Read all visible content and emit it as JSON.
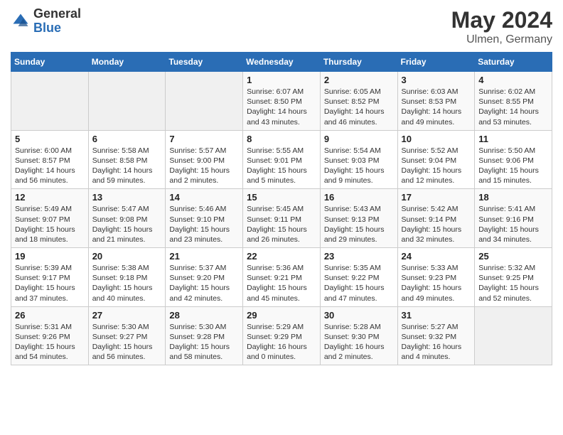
{
  "header": {
    "logo_general": "General",
    "logo_blue": "Blue",
    "month_year": "May 2024",
    "location": "Ulmen, Germany"
  },
  "weekdays": [
    "Sunday",
    "Monday",
    "Tuesday",
    "Wednesday",
    "Thursday",
    "Friday",
    "Saturday"
  ],
  "weeks": [
    [
      {
        "day": "",
        "info": ""
      },
      {
        "day": "",
        "info": ""
      },
      {
        "day": "",
        "info": ""
      },
      {
        "day": "1",
        "info": "Sunrise: 6:07 AM\nSunset: 8:50 PM\nDaylight: 14 hours\nand 43 minutes."
      },
      {
        "day": "2",
        "info": "Sunrise: 6:05 AM\nSunset: 8:52 PM\nDaylight: 14 hours\nand 46 minutes."
      },
      {
        "day": "3",
        "info": "Sunrise: 6:03 AM\nSunset: 8:53 PM\nDaylight: 14 hours\nand 49 minutes."
      },
      {
        "day": "4",
        "info": "Sunrise: 6:02 AM\nSunset: 8:55 PM\nDaylight: 14 hours\nand 53 minutes."
      }
    ],
    [
      {
        "day": "5",
        "info": "Sunrise: 6:00 AM\nSunset: 8:57 PM\nDaylight: 14 hours\nand 56 minutes."
      },
      {
        "day": "6",
        "info": "Sunrise: 5:58 AM\nSunset: 8:58 PM\nDaylight: 14 hours\nand 59 minutes."
      },
      {
        "day": "7",
        "info": "Sunrise: 5:57 AM\nSunset: 9:00 PM\nDaylight: 15 hours\nand 2 minutes."
      },
      {
        "day": "8",
        "info": "Sunrise: 5:55 AM\nSunset: 9:01 PM\nDaylight: 15 hours\nand 5 minutes."
      },
      {
        "day": "9",
        "info": "Sunrise: 5:54 AM\nSunset: 9:03 PM\nDaylight: 15 hours\nand 9 minutes."
      },
      {
        "day": "10",
        "info": "Sunrise: 5:52 AM\nSunset: 9:04 PM\nDaylight: 15 hours\nand 12 minutes."
      },
      {
        "day": "11",
        "info": "Sunrise: 5:50 AM\nSunset: 9:06 PM\nDaylight: 15 hours\nand 15 minutes."
      }
    ],
    [
      {
        "day": "12",
        "info": "Sunrise: 5:49 AM\nSunset: 9:07 PM\nDaylight: 15 hours\nand 18 minutes."
      },
      {
        "day": "13",
        "info": "Sunrise: 5:47 AM\nSunset: 9:08 PM\nDaylight: 15 hours\nand 21 minutes."
      },
      {
        "day": "14",
        "info": "Sunrise: 5:46 AM\nSunset: 9:10 PM\nDaylight: 15 hours\nand 23 minutes."
      },
      {
        "day": "15",
        "info": "Sunrise: 5:45 AM\nSunset: 9:11 PM\nDaylight: 15 hours\nand 26 minutes."
      },
      {
        "day": "16",
        "info": "Sunrise: 5:43 AM\nSunset: 9:13 PM\nDaylight: 15 hours\nand 29 minutes."
      },
      {
        "day": "17",
        "info": "Sunrise: 5:42 AM\nSunset: 9:14 PM\nDaylight: 15 hours\nand 32 minutes."
      },
      {
        "day": "18",
        "info": "Sunrise: 5:41 AM\nSunset: 9:16 PM\nDaylight: 15 hours\nand 34 minutes."
      }
    ],
    [
      {
        "day": "19",
        "info": "Sunrise: 5:39 AM\nSunset: 9:17 PM\nDaylight: 15 hours\nand 37 minutes."
      },
      {
        "day": "20",
        "info": "Sunrise: 5:38 AM\nSunset: 9:18 PM\nDaylight: 15 hours\nand 40 minutes."
      },
      {
        "day": "21",
        "info": "Sunrise: 5:37 AM\nSunset: 9:20 PM\nDaylight: 15 hours\nand 42 minutes."
      },
      {
        "day": "22",
        "info": "Sunrise: 5:36 AM\nSunset: 9:21 PM\nDaylight: 15 hours\nand 45 minutes."
      },
      {
        "day": "23",
        "info": "Sunrise: 5:35 AM\nSunset: 9:22 PM\nDaylight: 15 hours\nand 47 minutes."
      },
      {
        "day": "24",
        "info": "Sunrise: 5:33 AM\nSunset: 9:23 PM\nDaylight: 15 hours\nand 49 minutes."
      },
      {
        "day": "25",
        "info": "Sunrise: 5:32 AM\nSunset: 9:25 PM\nDaylight: 15 hours\nand 52 minutes."
      }
    ],
    [
      {
        "day": "26",
        "info": "Sunrise: 5:31 AM\nSunset: 9:26 PM\nDaylight: 15 hours\nand 54 minutes."
      },
      {
        "day": "27",
        "info": "Sunrise: 5:30 AM\nSunset: 9:27 PM\nDaylight: 15 hours\nand 56 minutes."
      },
      {
        "day": "28",
        "info": "Sunrise: 5:30 AM\nSunset: 9:28 PM\nDaylight: 15 hours\nand 58 minutes."
      },
      {
        "day": "29",
        "info": "Sunrise: 5:29 AM\nSunset: 9:29 PM\nDaylight: 16 hours\nand 0 minutes."
      },
      {
        "day": "30",
        "info": "Sunrise: 5:28 AM\nSunset: 9:30 PM\nDaylight: 16 hours\nand 2 minutes."
      },
      {
        "day": "31",
        "info": "Sunrise: 5:27 AM\nSunset: 9:32 PM\nDaylight: 16 hours\nand 4 minutes."
      },
      {
        "day": "",
        "info": ""
      }
    ]
  ]
}
